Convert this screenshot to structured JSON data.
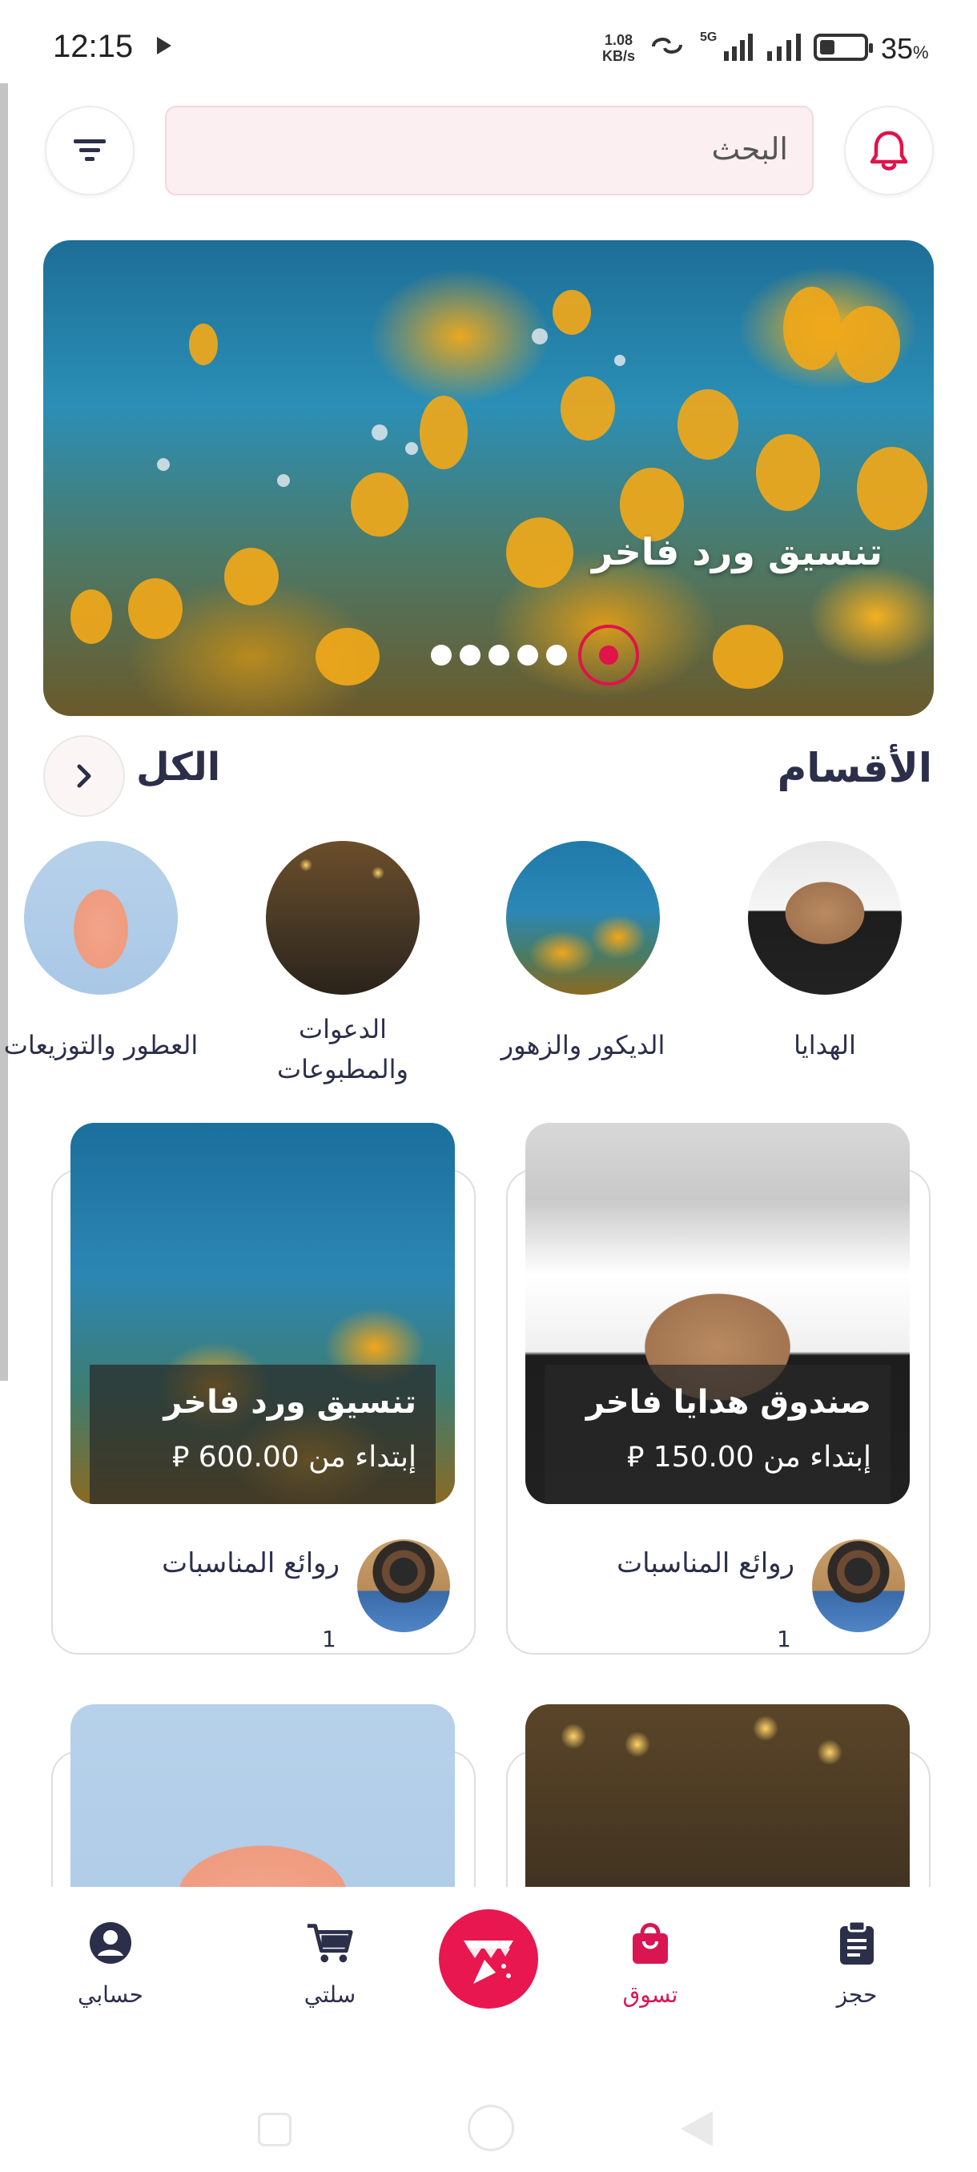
{
  "status_bar": {
    "time": "12:15",
    "speed_value": "1.08",
    "speed_unit": "KB/s",
    "network": "5G",
    "battery_level": 0.35,
    "battery_percent": "35",
    "battery_symbol": "%"
  },
  "header": {
    "search_placeholder": "البحث",
    "filter_icon": "filter-icon",
    "bell_icon": "bell-icon"
  },
  "hero": {
    "title": "تنسيق ورد فاخر",
    "slide_count": 6,
    "active_slide": 1
  },
  "categories": {
    "title": "الأقسام",
    "all_label": "الكل",
    "items": [
      {
        "label": "الهدايا"
      },
      {
        "label": "الديكور والزهور"
      },
      {
        "label": "الدعوات والمطبوعات"
      },
      {
        "label": "العطور والتوزيعات"
      }
    ]
  },
  "products": [
    {
      "name": "صندوق هدايا فاخر",
      "price": "إبتداء من 150.00 ⃁",
      "shop": "روائع المناسبات",
      "count": "1"
    },
    {
      "name": "تنسيق ورد فاخر",
      "price": "إبتداء من 600.00 ⃁",
      "shop": "روائع المناسبات",
      "count": "1"
    }
  ],
  "bottom_nav": {
    "items": [
      {
        "label": "حسابي",
        "icon": "account-icon"
      },
      {
        "label": "سلتي",
        "icon": "cart-icon"
      },
      {
        "label": "تسوق",
        "icon": "shopping-bag-icon"
      },
      {
        "label": "حجز",
        "icon": "clipboard-icon"
      }
    ],
    "center_icon": "party-icon",
    "active_color": "#d91652",
    "accent": "#e8174f"
  }
}
